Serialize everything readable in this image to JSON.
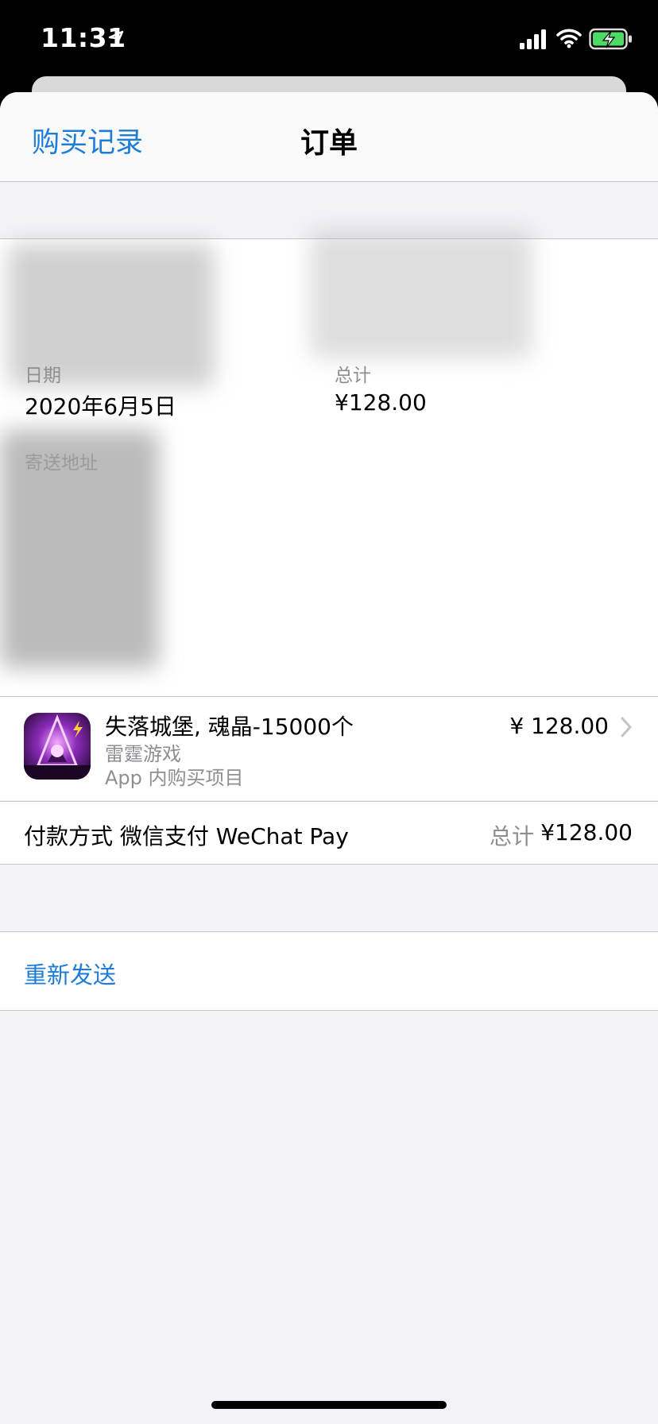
{
  "status_bar": {
    "time": "11:31"
  },
  "nav": {
    "back_label": "购买记录",
    "title": "订单"
  },
  "info": {
    "date_label": "日期",
    "date_value": "2020年6月5日",
    "total_label": "总计",
    "total_value": "¥128.00",
    "shipping_label": "寄送地址"
  },
  "item": {
    "name": "失落城堡, 魂晶-15000个",
    "developer": "雷霆游戏",
    "type": "App 内购买项目",
    "price": "¥ 128.00"
  },
  "payment": {
    "method": "付款方式 微信支付 WeChat Pay",
    "total_label": "总计",
    "total_value": "¥128.00"
  },
  "actions": {
    "resend": "重新发送"
  },
  "colors": {
    "accent": "#1c7cd6",
    "secondary_text": "#8e8e93",
    "background": "#f2f2f7"
  },
  "icons": [
    "location-arrow-icon",
    "cellular-signal-icon",
    "wifi-icon",
    "battery-charging-icon",
    "chevron-right-icon"
  ]
}
